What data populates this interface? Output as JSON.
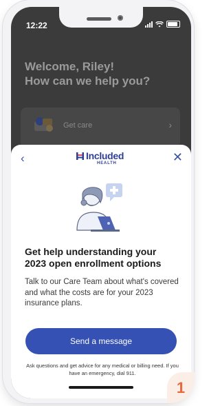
{
  "status_bar": {
    "time": "12:22"
  },
  "background_screen": {
    "welcome_line1": "Welcome, Riley!",
    "welcome_line2": "How can we help you?",
    "card_label": "Get care",
    "card_chevron": "›"
  },
  "sheet": {
    "back_icon": "‹",
    "close_icon": "✕",
    "logo_text": "Included",
    "logo_sub": "HEALTH",
    "headline": "Get help understanding your 2023 open enrollment options",
    "body": "Talk to our Care Team about what's covered and what the costs are for your 2023 insurance plans.",
    "cta_label": "Send a message",
    "footnote": "Ask questions and get advice for any medical or billing need. If you have an emergency, dial 911."
  },
  "step_badge": "1",
  "colors": {
    "brand": "#3651b4",
    "badge": "#e56a3d"
  }
}
